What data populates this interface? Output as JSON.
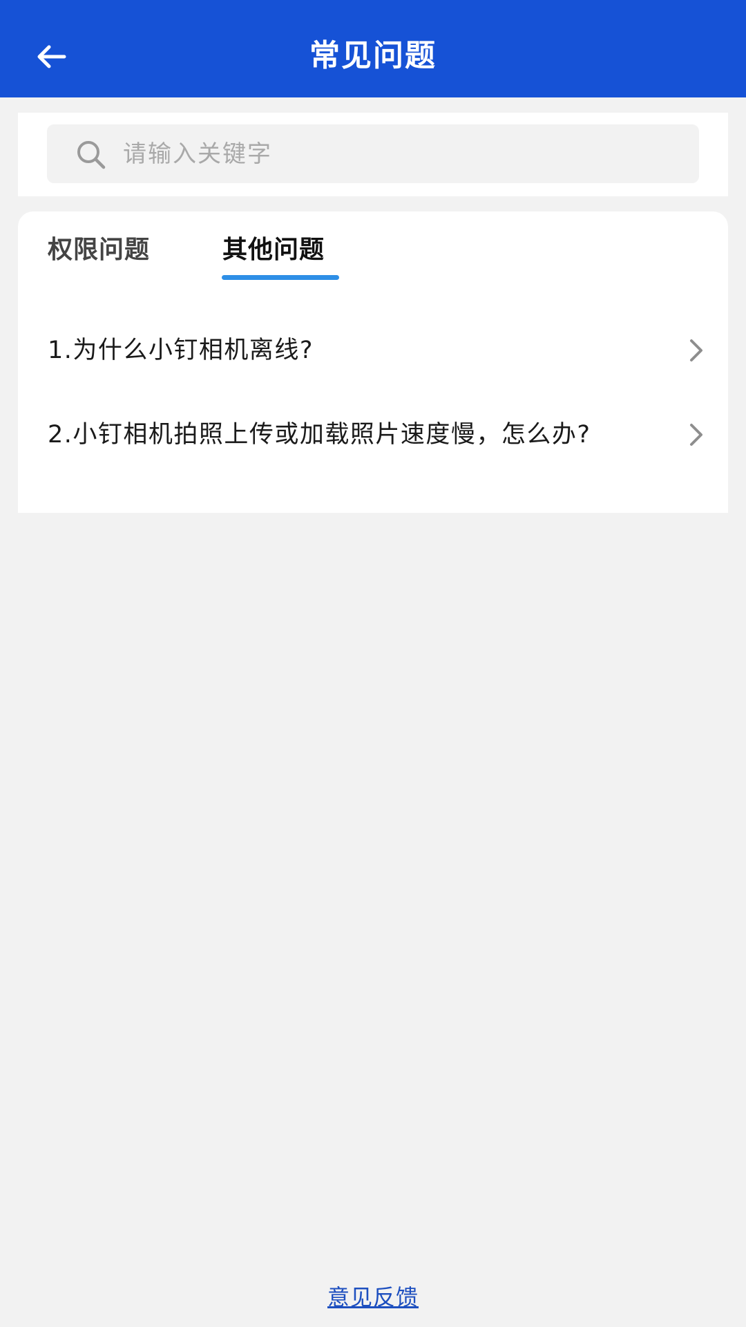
{
  "header": {
    "title": "常见问题",
    "back_icon": "arrow-left-icon"
  },
  "search": {
    "placeholder": "请输入关键字",
    "icon": "search-icon"
  },
  "tabs": [
    {
      "label": "权限问题",
      "active": false
    },
    {
      "label": "其他问题",
      "active": true
    }
  ],
  "faq": [
    {
      "text": "1.为什么小钉相机离线?"
    },
    {
      "text": "2.小钉相机拍照上传或加载照片速度慢，怎么办?"
    }
  ],
  "footer": {
    "feedback_label": "意见反馈"
  },
  "colors": {
    "header_bg": "#1652d6",
    "page_bg": "#f2f2f2",
    "tab_indicator": "#2e8fe6",
    "link": "#1d4fbf"
  }
}
